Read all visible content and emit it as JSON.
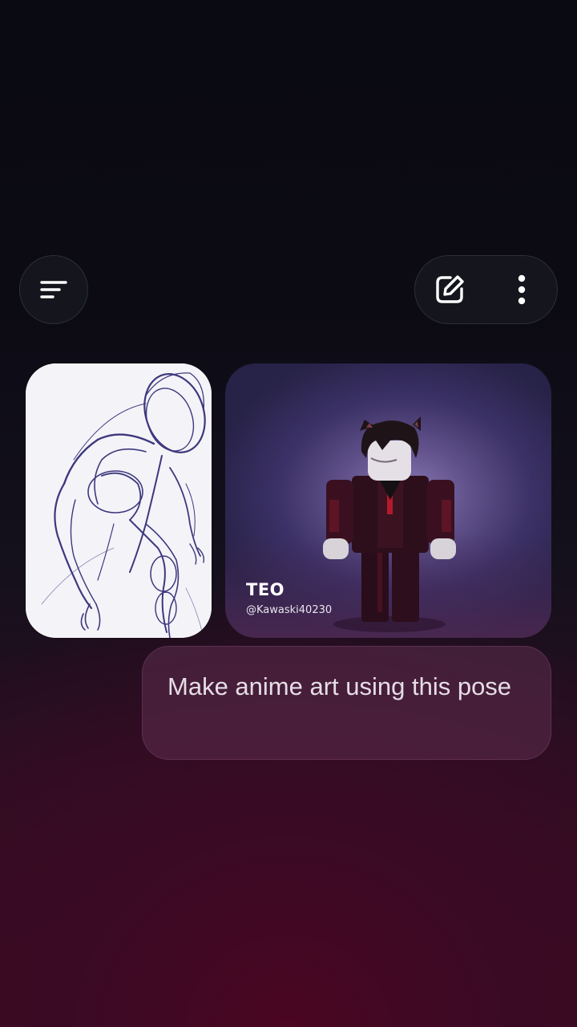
{
  "header": {
    "menu_icon": "menu-lines-icon",
    "edit_icon": "edit-square-pencil-icon",
    "more_icon": "more-vertical-icon"
  },
  "attachments": [
    {
      "type": "image",
      "description_icon": "sketch-pose-image"
    },
    {
      "type": "image",
      "name": "TEO",
      "handle": "@Kawaski40230"
    }
  ],
  "message": {
    "text": "Make anime art using this pose"
  },
  "colors": {
    "background_top": "#0a0a12",
    "background_bottom": "#3e0820",
    "button_bg": "#14151d",
    "bubble_bg": "#5c2e4e",
    "text": "#e6dde6"
  }
}
